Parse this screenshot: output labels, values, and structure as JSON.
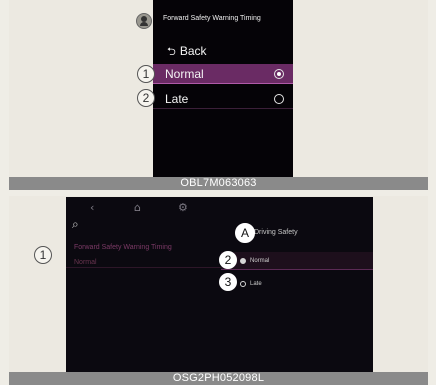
{
  "top_figure": {
    "caption": "OBL7M063063",
    "title": "Forward Safety Warning Timing",
    "back_label": "Back",
    "back_icon": "return-arrow-icon",
    "options": [
      {
        "callout": "1",
        "label": "Normal",
        "selected": true
      },
      {
        "callout": "2",
        "label": "Late",
        "selected": false
      }
    ]
  },
  "bottom_figure": {
    "caption": "OSG2PH052098L",
    "menu_title": "Driving Safety",
    "callout_a": "A",
    "left_item": {
      "callout": "1",
      "title": "Forward Safety Warning Timing",
      "value": "Normal"
    },
    "options": [
      {
        "callout": "2",
        "label": "Normal",
        "selected": true
      },
      {
        "callout": "3",
        "label": "Late",
        "selected": false
      }
    ]
  },
  "colors": {
    "accent": "#6a2b64",
    "screen": "#050307",
    "caption_bar": "#8a8a8a"
  }
}
